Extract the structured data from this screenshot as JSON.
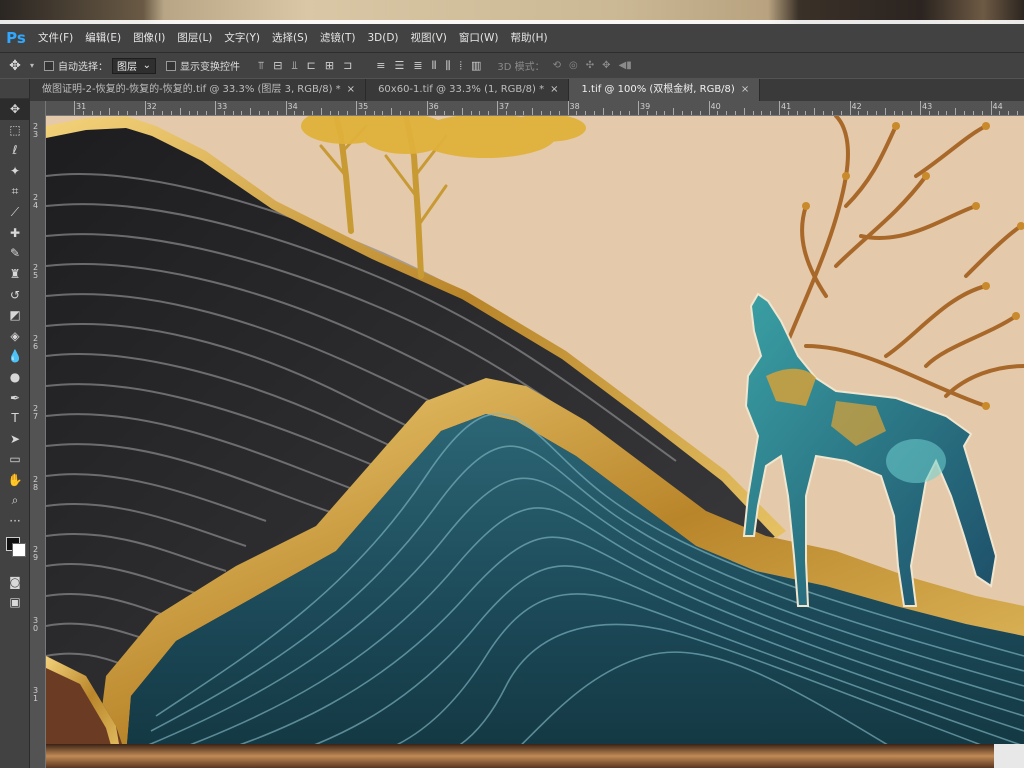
{
  "app": {
    "logo": "Ps"
  },
  "menu": [
    "文件(F)",
    "编辑(E)",
    "图像(I)",
    "图层(L)",
    "文字(Y)",
    "选择(S)",
    "滤镜(T)",
    "3D(D)",
    "视图(V)",
    "窗口(W)",
    "帮助(H)"
  ],
  "options": {
    "auto_select_label": "自动选择：",
    "auto_select_value": "图层",
    "show_transform_label": "显示变换控件",
    "mode_3d_label": "3D 模式："
  },
  "tabs": [
    {
      "label": "做图证明-2-恢复的-恢复的-恢复的.tif @ 33.3% (图层 3, RGB/8) *",
      "active": false
    },
    {
      "label": "60x60-1.tif @ 33.3% (1, RGB/8) *",
      "active": false
    },
    {
      "label": "1.tif @ 100% (双根金树, RGB/8)",
      "active": true
    }
  ],
  "ruler_top": [
    "31",
    "32",
    "33",
    "34",
    "35",
    "36",
    "37",
    "38",
    "39",
    "40",
    "41",
    "42",
    "43",
    "44"
  ],
  "ruler_left": [
    "2 3",
    "2 4",
    "2 5",
    "2 6",
    "2 7",
    "2 8",
    "2 9",
    "3 0",
    "3 1"
  ],
  "tools": [
    "move-icon",
    "marquee-icon",
    "lasso-icon",
    "magic-wand-icon",
    "crop-icon",
    "eyedropper-icon",
    "healing-brush-icon",
    "brush-icon",
    "clone-stamp-icon",
    "history-brush-icon",
    "eraser-icon",
    "paint-bucket-icon",
    "blur-icon",
    "dodge-icon",
    "pen-icon",
    "type-icon",
    "path-selection-icon",
    "rectangle-icon",
    "hand-icon",
    "zoom-icon",
    "more-tools-icon"
  ],
  "colors": {
    "menubar": "#424242",
    "workspace": "#535353",
    "canvas_bg": "#e3c9ad",
    "gold": "#c99a2e",
    "teal": "#1f4f5e"
  }
}
